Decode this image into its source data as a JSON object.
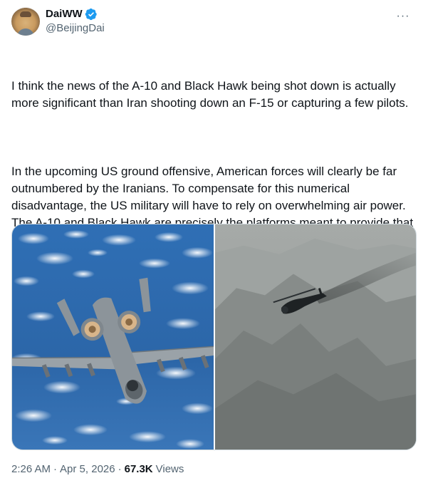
{
  "author": {
    "display_name": "DaiWW",
    "handle": "@BeijingDai",
    "avatar_icon": "user-avatar",
    "verified_icon": "verified-badge-icon",
    "verified_color": "#1d9bf0"
  },
  "menu": {
    "more_icon": "more-options-icon",
    "more_label": "···"
  },
  "tweet": {
    "paragraphs": [
      "I think the news of the A-10 and Black Hawk being shot down is actually more significant than Iran shooting down an F-15 or capturing a few pilots.",
      "In the upcoming US ground offensive, American forces will clearly be far outnumbered by the Iranians. To compensate for this numerical disadvantage, the US military will have to rely on overwhelming air power. The A-10 and Black Hawk are precisely the platforms meant to provide that kind of fire support — and Iran has now proven it has the capability to shoot them down. This will only make the US military feel even more despair about the coming ground battle."
    ]
  },
  "media": {
    "images": [
      {
        "subject": "a10-aircraft-photo"
      },
      {
        "subject": "black-hawk-helicopter-photo"
      }
    ]
  },
  "footer": {
    "time": "2:26 AM",
    "separator": "·",
    "date": "Apr 5, 2026",
    "views_count": "67.3K",
    "views_label": "Views"
  }
}
